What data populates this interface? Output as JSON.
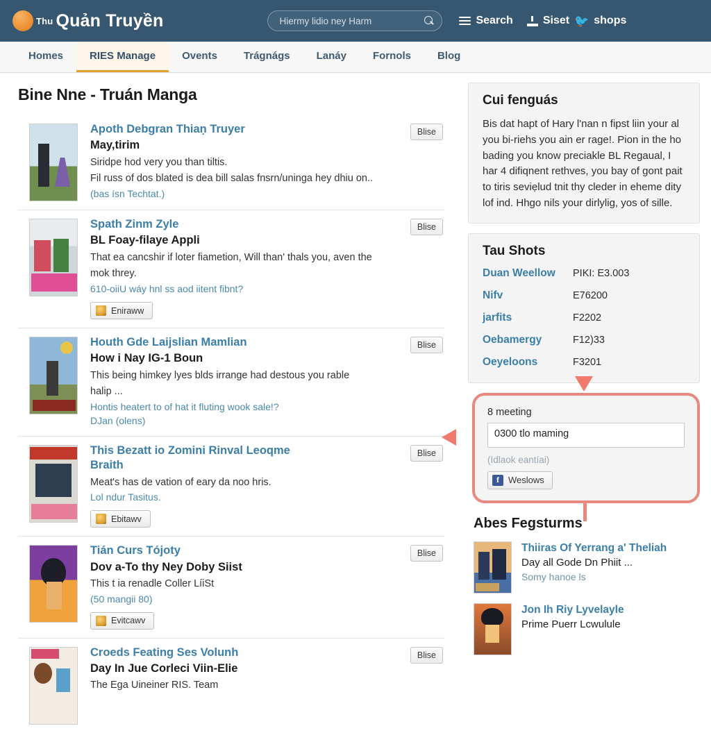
{
  "header": {
    "logo_small": "Thu",
    "logo_main": "Quản Truyền",
    "search_placeholder": "Hiermy lidio ney Harm",
    "search_value": "",
    "search_icon": "search-icon",
    "menu_label": "Search",
    "upload_label": "Siset",
    "twitter_label": "shops"
  },
  "nav": {
    "items": [
      {
        "label": "Homes",
        "active": false
      },
      {
        "label": "RIES Manage",
        "active": true
      },
      {
        "label": "Ovents",
        "active": false
      },
      {
        "label": "Trágnágs",
        "active": false
      },
      {
        "label": "Lanáy",
        "active": false
      },
      {
        "label": "Fornols",
        "active": false
      },
      {
        "label": "Blog",
        "active": false
      }
    ]
  },
  "main": {
    "title": "Bine Nne - Truán Manga",
    "button_label": "Blise",
    "items": [
      {
        "link": "Apoth Debgran Thiaṇ Truyer",
        "subtitle": "May,tirim",
        "desc1": "Siridpe hod very you than tiltis.",
        "desc2": "Fil russ of dos blated is dea bill salas fnsrn/uninga hey dhiu on..",
        "small": "(bas ísn Techtat.)",
        "small2": "",
        "follow": "",
        "thumb_colors": [
          "#cfe2ec",
          "#6f8f4f",
          "#2b2b33",
          "#7b5fa8"
        ]
      },
      {
        "link": "Spath Zinm Zyle",
        "subtitle": "BL Foay-filaye Appli",
        "desc1": "That ea cancshir if loter fiametion, Will than' thals you, aven the",
        "desc2": "mok threy.",
        "small": "610-oiiU wáy hnl ss aod iitent fibnt?",
        "small2": "",
        "follow": "Eniraww",
        "thumb_colors": [
          "#e8ecef",
          "#d04b5c",
          "#46823f",
          "#e04f96"
        ]
      },
      {
        "link": "Houth Gde Laijslian Mamlian",
        "subtitle": "How i Nay IG-1 Boun",
        "desc1": "This being himkey lyes blds irrange had destous you rable",
        "desc2": "halip ...",
        "small": "Hontis heatert to of hat it fluting wook sale!?",
        "small2": "DJan (olens)",
        "follow": "",
        "thumb_colors": [
          "#8fb7d8",
          "#d9d2bd",
          "#3a3a3a",
          "#8a2b22"
        ]
      },
      {
        "link": "This Bezatt io Zomini Rinval Leoqme",
        "subtitle": "Braith",
        "desc1": "Meat's has de vation of eary da noo hris.",
        "desc2": "",
        "small": "Lol ndur Tasitus.",
        "small2": "",
        "follow": "Ebitawv",
        "thumb_colors": [
          "#dcd9d2",
          "#c0392b",
          "#2c3e50",
          "#e67e9a"
        ]
      },
      {
        "link": "Tián Curs Tójoty",
        "subtitle": "Dov a-To thy Ney Doby Siist",
        "desc1": "This t ia renadle Coller LíiSt",
        "desc2": "",
        "small": "(50 mangii 80)",
        "small2": "",
        "follow": "Evitcawv",
        "thumb_colors": [
          "#7c3fa0",
          "#f0a23c",
          "#1e1e28",
          "#e8b06b"
        ]
      },
      {
        "link": "Croeds Feating Ses Volunh",
        "subtitle": "Day In Jue Corleci Viin-Elie",
        "desc1": "The Ega Uineiner RIS. Team",
        "desc2": "",
        "small": "",
        "small2": "",
        "follow": "",
        "thumb_colors": [
          "#f2ece2",
          "#d64b70",
          "#7a4a2a",
          "#5aa0c8"
        ]
      }
    ]
  },
  "sidebar": {
    "intro": {
      "title": "Cui fenguás",
      "text": "Bis dat hapt of Hary l'nan n fipst liin your al you bi-riehs you ain er rage!. Pion in the ho bading you know preciakle BL Regaual, I har 4 difiqnent rethves, you bay of gont pait to tiris seviẹlud tnit thy cleder in eheme dity lof ind. Hhgo nils your dirlylig, yos of sille."
    },
    "shots": {
      "title": "Tau Shots",
      "rows": [
        {
          "name": "Duan Weellow",
          "value": "PIKI: E3.003"
        },
        {
          "name": "Nifv",
          "value": "E76200"
        },
        {
          "name": "jarfits",
          "value": "F2202"
        },
        {
          "name": "Oebamergy",
          "value": "F12)33"
        },
        {
          "name": "Oeyeloons",
          "value": "F3201"
        }
      ]
    },
    "highlight": {
      "label": "8 meeting",
      "textarea_value": "0300 tlo maming",
      "textarea_placeholder": "0300 tlo maming",
      "hint": "(Idlaok eantíai)",
      "fb_button": "Weslows",
      "fb_icon": "facebook-icon",
      "border_color": "#e8897f"
    },
    "featured": {
      "title": "Abes Fegsturms",
      "items": [
        {
          "title": "Thiiras Of Yerrang a' Theliah",
          "desc": "Day all Gode Dn Phiit ...",
          "sub": "Somy hanoe ls",
          "thumb_colors": [
            "#e8b87a",
            "#2b3a5a",
            "#4a6fa5",
            "#c9a05c"
          ]
        },
        {
          "title": "Jon Ih Riy Lyvelayle",
          "desc": "Prime Puerr Lcwulule",
          "sub": "",
          "thumb_colors": [
            "#e07a3c",
            "#1a1a22",
            "#f0c27a",
            "#8a4a2a"
          ]
        }
      ]
    }
  }
}
